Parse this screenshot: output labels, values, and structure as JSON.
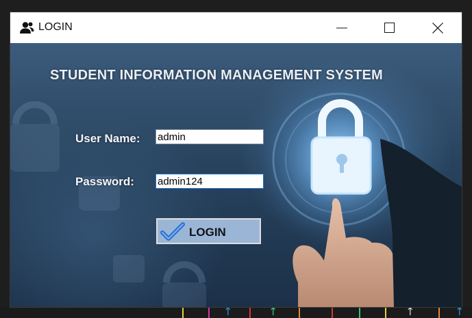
{
  "window": {
    "title": "LOGIN",
    "icon": "users-icon",
    "controls": [
      "minimize-icon",
      "maximize-icon",
      "close-icon"
    ]
  },
  "app": {
    "heading": "STUDENT INFORMATION MANAGEMENT SYSTEM"
  },
  "form": {
    "username_label": "User Name:",
    "username_value": "admin",
    "password_label": "Password:",
    "password_value": "admin124",
    "login_button_label": "LOGIN",
    "login_button_icon": "checkmark-icon"
  },
  "colors": {
    "button_bg": "#9ab5d6",
    "background_dark": "#1c3048",
    "heading_text": "#e9eef5"
  }
}
